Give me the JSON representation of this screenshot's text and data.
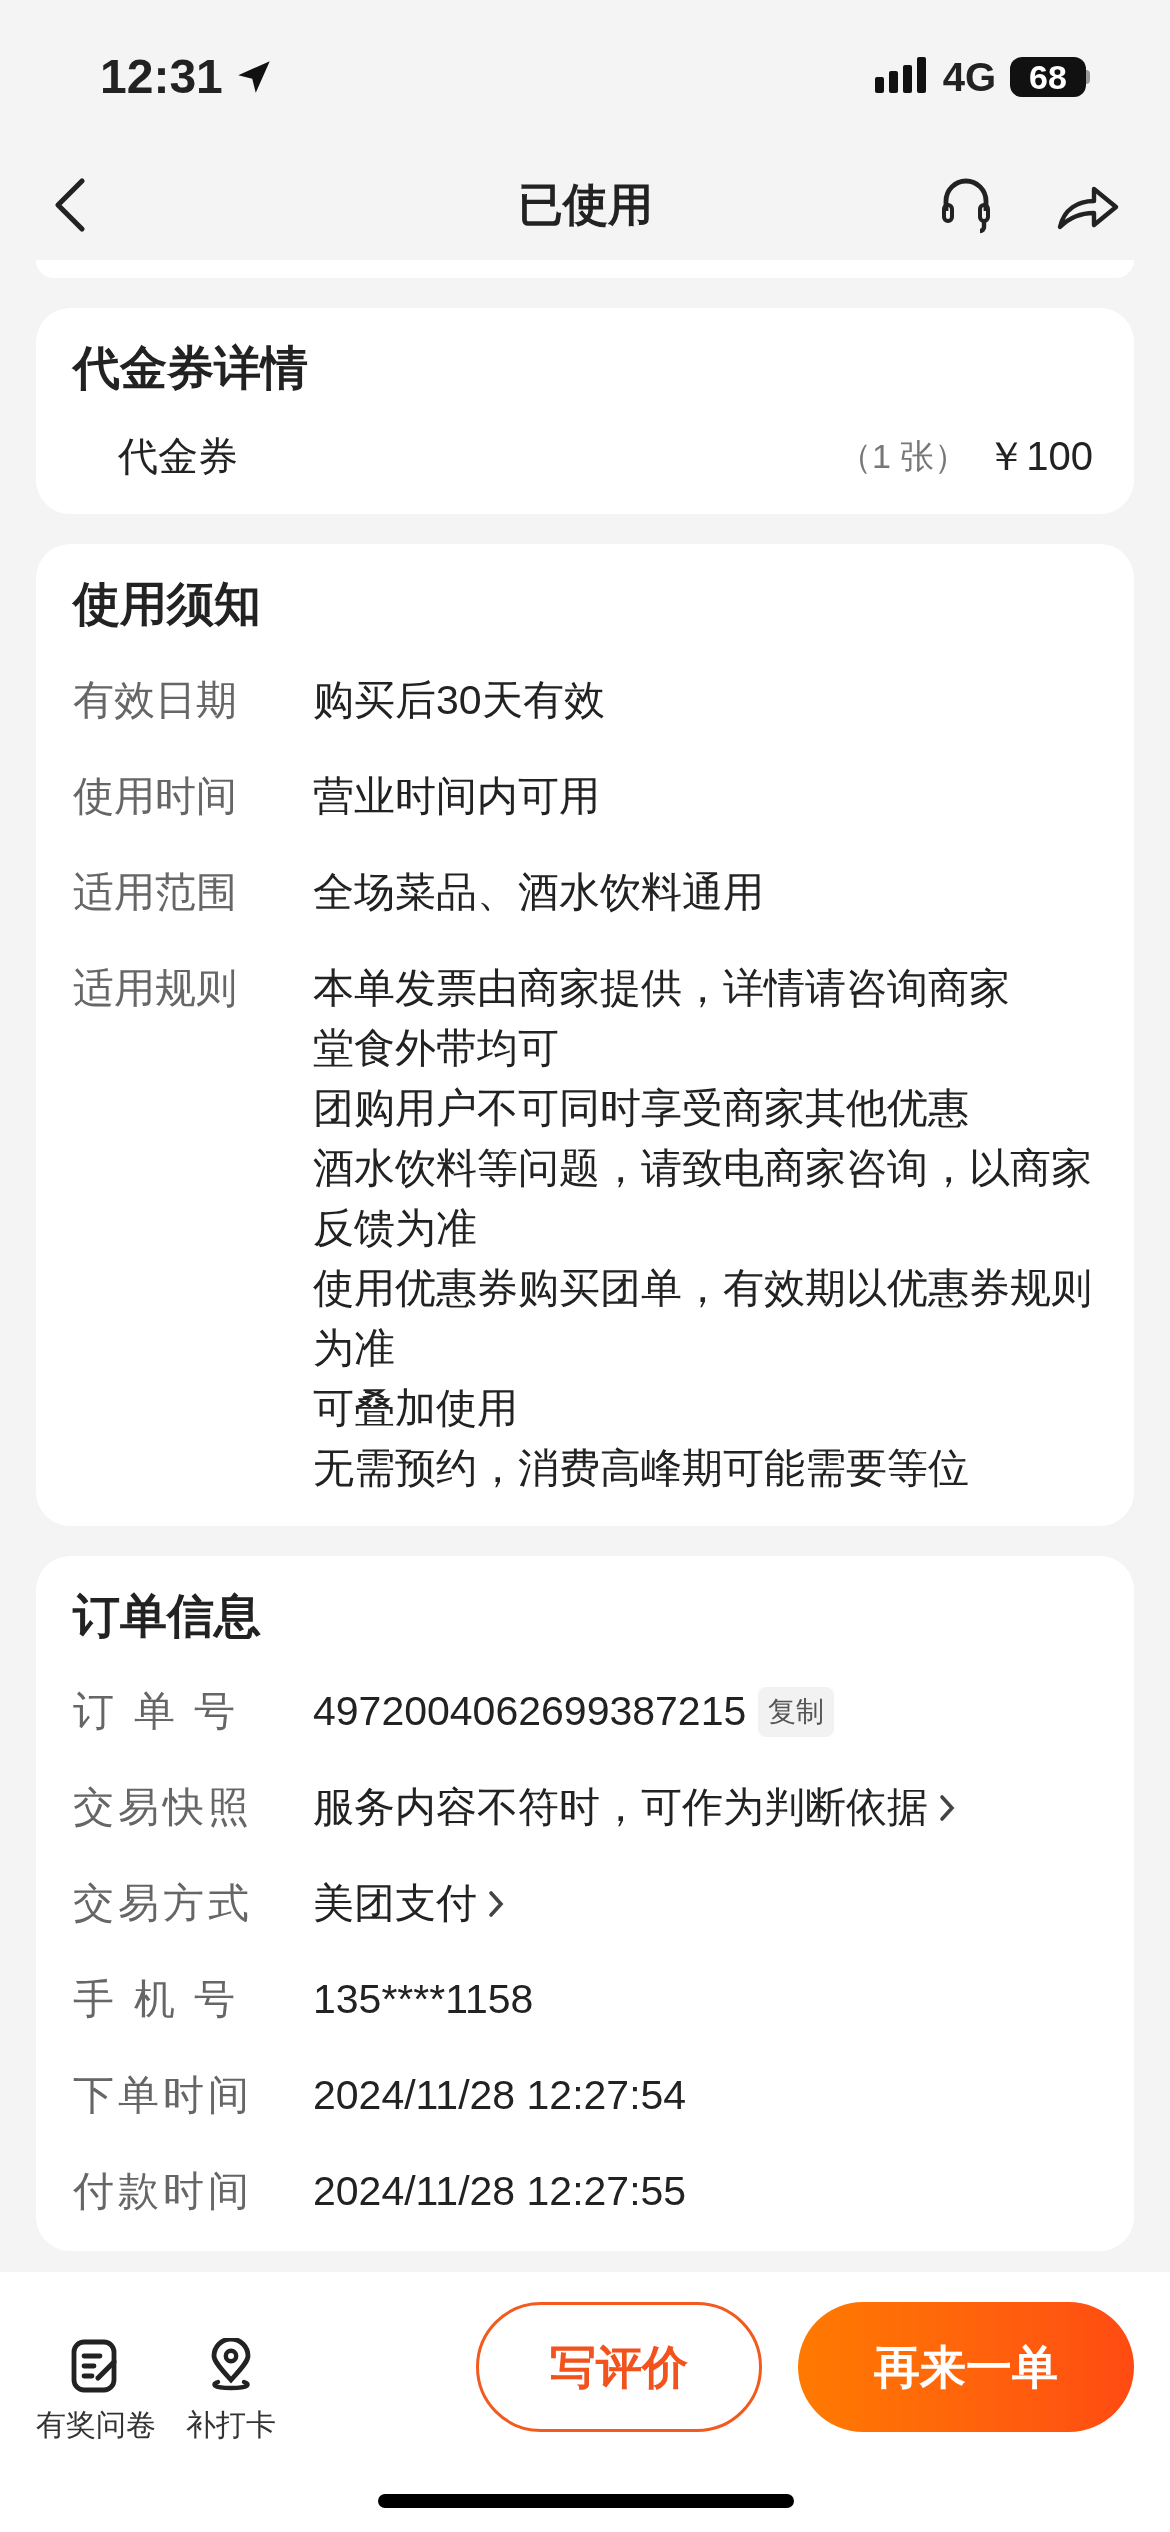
{
  "status_bar": {
    "time": "12:31",
    "network": "4G",
    "battery": "68"
  },
  "nav": {
    "title": "已使用"
  },
  "voucher_details": {
    "title": "代金券详情",
    "items": [
      {
        "name": "代金券",
        "quantity": "（1 张）",
        "price": "￥100"
      }
    ]
  },
  "usage_notes": {
    "title": "使用须知",
    "rows": [
      {
        "label": "有效日期",
        "lines": [
          "购买后30天有效"
        ]
      },
      {
        "label": "使用时间",
        "lines": [
          "营业时间内可用"
        ]
      },
      {
        "label": "适用范围",
        "lines": [
          "全场菜品、酒水饮料通用"
        ]
      },
      {
        "label": "适用规则",
        "lines": [
          "本单发票由商家提供，详情请咨询商家",
          "堂食外带均可",
          "团购用户不可同时享受商家其他优惠",
          "酒水饮料等问题，请致电商家咨询，以商家反馈为准",
          "使用优惠券购买团单，有效期以优惠券规则为准",
          "可叠加使用",
          "无需预约，消费高峰期可能需要等位"
        ]
      }
    ]
  },
  "order_info": {
    "title": "订单信息",
    "rows": [
      {
        "label": "订 单 号",
        "value": "4972004062699387215",
        "kind": "copy",
        "action": "复制"
      },
      {
        "label": "交易快照",
        "value": "服务内容不符时，可作为判断依据",
        "kind": "link"
      },
      {
        "label": "交易方式",
        "value": "美团支付",
        "kind": "link"
      },
      {
        "label": "手 机 号",
        "value": "135****1158",
        "kind": "plain"
      },
      {
        "label": "下单时间",
        "value": "2024/11/28 12:27:54",
        "kind": "plain"
      },
      {
        "label": "付款时间",
        "value": "2024/11/28 12:27:55",
        "kind": "plain"
      }
    ]
  },
  "bottom_bar": {
    "shortcuts": [
      {
        "label": "有奖问卷",
        "kind": "survey"
      },
      {
        "label": "补打卡",
        "kind": "checkin"
      }
    ],
    "buttons": [
      {
        "label": "写评价",
        "kind": "outline"
      },
      {
        "label": "再来一单",
        "kind": "primary"
      }
    ]
  }
}
